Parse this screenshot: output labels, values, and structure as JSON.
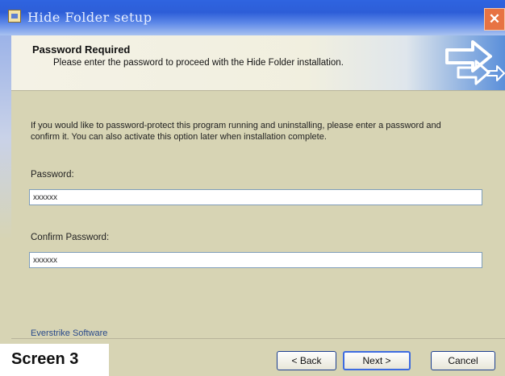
{
  "window": {
    "title": "Hide Folder setup",
    "close_glyph": "✕"
  },
  "header": {
    "title": "Password Required",
    "subtitle": "Please enter the password to proceed with the Hide Folder installation.",
    "logo_icon": "arrows-logo-icon"
  },
  "body": {
    "description": "If you would like to password-protect this program running and uninstalling, please enter a password and confirm it. You can also activate this option later when installation complete.",
    "password_label": "Password:",
    "password_value": "xxxxxx",
    "confirm_label": "Confirm Password:",
    "confirm_value": "xxxxxx"
  },
  "footer": {
    "company": "Everstrike Software",
    "back_label": "< Back",
    "next_label": "Next >",
    "cancel_label": "Cancel"
  },
  "overlay": {
    "screen_label": "Screen 3"
  },
  "colors": {
    "titlebar": "#2f64e0",
    "dialog_bg": "#d7d4b4",
    "close_button": "#e77343"
  }
}
